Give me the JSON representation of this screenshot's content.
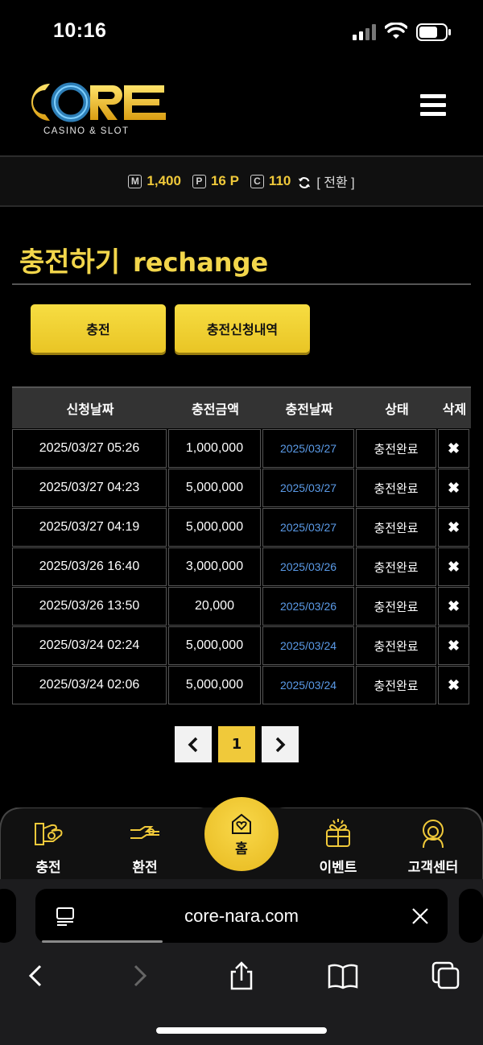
{
  "status_bar": {
    "time": "10:16"
  },
  "header": {
    "logo_text": "CORE",
    "logo_subtext": "CASINO & SLOT"
  },
  "wallet": {
    "money_icon": "M",
    "money": "1,400",
    "point_icon": "P",
    "points": "16 P",
    "coin_icon": "C",
    "coins": "110",
    "switch_label": "[ 전환 ]"
  },
  "page": {
    "title_ko": "충전하기",
    "title_en": "rechange"
  },
  "buttons": {
    "charge": "충전",
    "history": "충전신청내역"
  },
  "table": {
    "headers": [
      "신청날짜",
      "충전금액",
      "충전날짜",
      "상태",
      "삭제"
    ],
    "rows": [
      {
        "requested": "2025/03/27 05:26",
        "amount": "1,000,000",
        "charged": "2025/03/27",
        "status": "충전완료",
        "delete": "✖"
      },
      {
        "requested": "2025/03/27 04:23",
        "amount": "5,000,000",
        "charged": "2025/03/27",
        "status": "충전완료",
        "delete": "✖"
      },
      {
        "requested": "2025/03/27 04:19",
        "amount": "5,000,000",
        "charged": "2025/03/27",
        "status": "충전완료",
        "delete": "✖"
      },
      {
        "requested": "2025/03/26 16:40",
        "amount": "3,000,000",
        "charged": "2025/03/26",
        "status": "충전완료",
        "delete": "✖"
      },
      {
        "requested": "2025/03/26 13:50",
        "amount": "20,000",
        "charged": "2025/03/26",
        "status": "충전완료",
        "delete": "✖"
      },
      {
        "requested": "2025/03/24 02:24",
        "amount": "5,000,000",
        "charged": "2025/03/24",
        "status": "충전완료",
        "delete": "✖"
      },
      {
        "requested": "2025/03/24 02:06",
        "amount": "5,000,000",
        "charged": "2025/03/24",
        "status": "충전완료",
        "delete": "✖"
      }
    ]
  },
  "pagination": {
    "prev": "‹",
    "current": "1",
    "next": "›"
  },
  "bottom_nav": {
    "charge": "충전",
    "exchange": "환전",
    "home": "홈",
    "event": "이벤트",
    "support": "고객센터"
  },
  "browser": {
    "url": "core-nara.com"
  },
  "colors": {
    "accent": "#f0c93a",
    "background": "#000000",
    "date_link": "#5b9be8"
  }
}
